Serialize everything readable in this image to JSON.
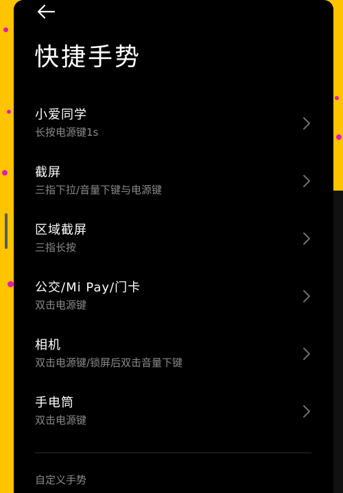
{
  "header": {
    "back_icon": "back-arrow-icon",
    "title": "快捷手势"
  },
  "items": [
    {
      "title": "小爱同学",
      "subtitle": "长按电源键1s",
      "icon": "chevron-right-icon"
    },
    {
      "title": "截屏",
      "subtitle": "三指下拉/音量下键与电源键",
      "icon": "chevron-right-icon"
    },
    {
      "title": "区域截屏",
      "subtitle": "三指长按",
      "icon": "chevron-right-icon"
    },
    {
      "title": "公交/Mi Pay/门卡",
      "subtitle": "双击电源键",
      "icon": "chevron-right-icon"
    },
    {
      "title": "相机",
      "subtitle": "双击电源键/锁屏后双击音量下键",
      "icon": "chevron-right-icon"
    },
    {
      "title": "手电筒",
      "subtitle": "双击电源键",
      "icon": "chevron-right-icon"
    }
  ],
  "section": {
    "custom_label": "自定义手势"
  },
  "colors": {
    "background_border": "#ffc400",
    "decoration_dots": "#e01ab8",
    "screen": "#000000",
    "title_text": "#ffffff",
    "subtitle_text": "#8a8a8a",
    "chevron": "#6e6e6e"
  }
}
